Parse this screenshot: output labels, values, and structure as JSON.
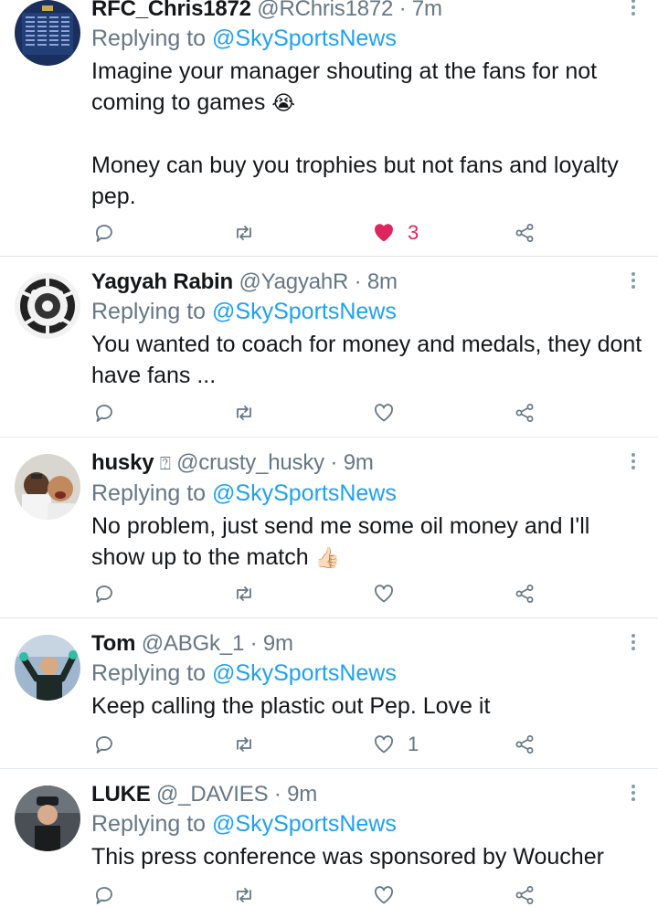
{
  "reply_prefix": "Replying to",
  "colors": {
    "accent": "#1da1f2",
    "like": "#e0245e",
    "muted": "#657786",
    "divider": "#e1e8ed"
  },
  "icons": {
    "reply": "reply-icon",
    "retweet": "retweet-icon",
    "like": "heart-icon",
    "share": "share-icon",
    "more": "more-vertical-icon"
  },
  "tweets": [
    {
      "display_name": "RFC_Chris1872",
      "handle": "@RChris1872",
      "time": "7m",
      "reply_to": "@SkySportsNews",
      "text_paragraphs": [
        "Imagine your manager shouting at the fans for not coming to games",
        "Money can buy you trophies but not fans and loyalty pep."
      ],
      "emoji": "😭",
      "like_count": "3",
      "liked": true
    },
    {
      "display_name": "Yagyah Rabin",
      "handle": "@YagyahR",
      "time": "8m",
      "reply_to": "@SkySportsNews",
      "text": "You wanted to coach for money and medals, they dont have fans ...",
      "like_count": "",
      "liked": false
    },
    {
      "display_name": "husky",
      "name_glyph": "⍰",
      "handle": "@crusty_husky",
      "time": "9m",
      "reply_to": "@SkySportsNews",
      "text": "No problem, just send me some oil money and I'll show up to the match",
      "emoji": "👍🏻",
      "like_count": "",
      "liked": false
    },
    {
      "display_name": "Tom",
      "handle": "@ABGk_1",
      "time": "9m",
      "reply_to": "@SkySportsNews",
      "text": "Keep calling the plastic out Pep. Love it",
      "like_count": "1",
      "liked": false
    },
    {
      "display_name": "LUKE",
      "handle": "@_DAVIES",
      "time": "9m",
      "reply_to": "@SkySportsNews",
      "text": "This press conference was sponsored by Woucher",
      "like_count": "",
      "liked": false
    }
  ]
}
